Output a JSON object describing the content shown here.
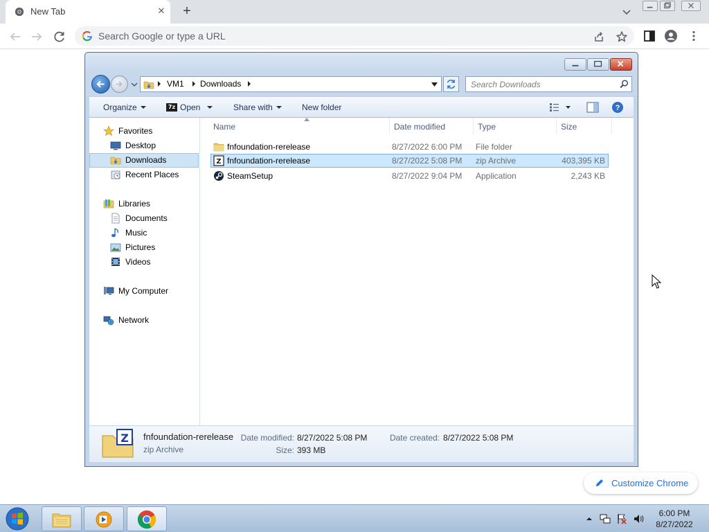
{
  "browser": {
    "tab_title": "New Tab",
    "omnibox_placeholder": "Search Google or type a URL",
    "customize_label": "Customize Chrome"
  },
  "explorer": {
    "breadcrumb": [
      "VM1",
      "Downloads"
    ],
    "search_placeholder": "Search Downloads",
    "commands": {
      "organize": "Organize",
      "open": "Open",
      "share_with": "Share with",
      "new_folder": "New folder"
    },
    "nav": {
      "favorites": "Favorites",
      "desktop": "Desktop",
      "downloads": "Downloads",
      "recent_places": "Recent Places",
      "libraries": "Libraries",
      "documents": "Documents",
      "music": "Music",
      "pictures": "Pictures",
      "videos": "Videos",
      "my_computer": "My Computer",
      "network": "Network"
    },
    "columns": {
      "name": "Name",
      "date_modified": "Date modified",
      "type": "Type",
      "size": "Size"
    },
    "files": [
      {
        "name": "fnfoundation-rerelease",
        "date": "8/27/2022 6:00 PM",
        "type": "File folder",
        "size": "",
        "icon": "folder-icon"
      },
      {
        "name": "fnfoundation-rerelease",
        "date": "8/27/2022 5:08 PM",
        "type": "zip Archive",
        "size": "403,395 KB",
        "icon": "7zip-archive-icon"
      },
      {
        "name": "SteamSetup",
        "date": "8/27/2022 9:04 PM",
        "type": "Application",
        "size": "2,243 KB",
        "icon": "steam-icon"
      }
    ],
    "details": {
      "name": "fnfoundation-rerelease",
      "type": "zip Archive",
      "date_modified_label": "Date modified:",
      "date_modified": "8/27/2022 5:08 PM",
      "size_label": "Size:",
      "size": "393 MB",
      "date_created_label": "Date created:",
      "date_created": "8/27/2022 5:08 PM"
    }
  },
  "taskbar": {
    "time": "6:00 PM",
    "date": "8/27/2022"
  },
  "colors": {
    "chrome_tabbar": "#dee1e6",
    "link_blue": "#1a73e8",
    "selection": "#cce8ff"
  }
}
